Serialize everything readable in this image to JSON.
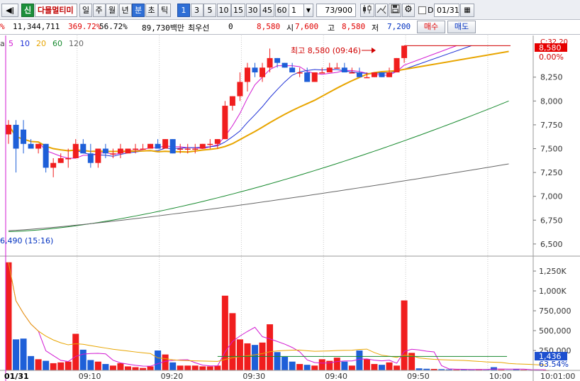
{
  "toolbar": {
    "speaker_icon": "speaker-icon",
    "code_button": "신",
    "stock_name": "다믈멀티미",
    "period_buttons": [
      "일",
      "주",
      "월",
      "년",
      "분",
      "초",
      "틱"
    ],
    "selected_period": "분",
    "interval_buttons": [
      "1",
      "3",
      "5",
      "10",
      "15",
      "30",
      "45",
      "60"
    ],
    "selected_interval": "1",
    "interval_select_value": "1",
    "count_value": "73/900",
    "icon_buttons": [
      "candle-icon",
      "cross-icon",
      "save-icon",
      "gear-icon"
    ],
    "date_checkbox_label": "D",
    "date_value": "01/31"
  },
  "info": {
    "left_cut": "%",
    "volume": "11,344,711",
    "volume_ratio": "369.72%",
    "turnover_ratio": "56.72%",
    "amount": "89,730백만",
    "prefer_label": "최우선",
    "prefer_value": "0",
    "price": "8,580",
    "open_label": "시",
    "open_value": "7,600",
    "high_label": "고",
    "high_value": "8,580",
    "low_label": "저",
    "low_value": "7,200",
    "buy_button": "매수",
    "sell_button": "매도"
  },
  "chart_data": [
    {
      "type": "candlestick",
      "legend_prefix": "a",
      "moving_averages": [
        {
          "name": "5",
          "color": "#d21ad2"
        },
        {
          "name": "10",
          "color": "#1d2fd6"
        },
        {
          "name": "20",
          "color": "#e8a500"
        },
        {
          "name": "60",
          "color": "#178a2e"
        },
        {
          "name": "120",
          "color": "#666666"
        }
      ],
      "y_ticks": [
        6500,
        6750,
        7000,
        7250,
        7500,
        7750,
        8000,
        8250
      ],
      "y_tick_labels": [
        "6,500",
        "6,750",
        "7,000",
        "7,250",
        "7,500",
        "7,750",
        "8,000",
        "8,250"
      ],
      "ylim": [
        6380,
        8650
      ],
      "top_label": "C:32.20",
      "current_price_label": "8,580",
      "change_label": "0.00%",
      "high_annotation": "최고 8,580 (09:46)",
      "low_annotation": "6,490 (15:16)",
      "candles": [
        [
          7650,
          7800,
          7550,
          7750
        ],
        [
          7750,
          7800,
          7250,
          7500
        ],
        [
          7700,
          7800,
          7450,
          7550
        ],
        [
          7550,
          7600,
          7500,
          7500
        ],
        [
          7500,
          7550,
          7450,
          7550
        ],
        [
          7550,
          7550,
          7250,
          7300
        ],
        [
          7300,
          7400,
          7200,
          7350
        ],
        [
          7350,
          7450,
          7350,
          7400
        ],
        [
          7400,
          7500,
          7300,
          7400
        ],
        [
          7400,
          7600,
          7400,
          7550
        ],
        [
          7550,
          7600,
          7450,
          7450
        ],
        [
          7450,
          7550,
          7300,
          7350
        ],
        [
          7350,
          7500,
          7300,
          7500
        ],
        [
          7500,
          7550,
          7400,
          7450
        ],
        [
          7450,
          7500,
          7400,
          7450
        ],
        [
          7450,
          7550,
          7400,
          7500
        ],
        [
          7450,
          7500,
          7450,
          7500
        ],
        [
          7500,
          7550,
          7450,
          7500
        ],
        [
          7500,
          7550,
          7500,
          7500
        ],
        [
          7500,
          7550,
          7500,
          7550
        ],
        [
          7550,
          7600,
          7500,
          7500
        ],
        [
          7500,
          7600,
          7500,
          7600
        ],
        [
          7600,
          7600,
          7450,
          7450
        ],
        [
          7500,
          7550,
          7450,
          7500
        ],
        [
          7500,
          7550,
          7450,
          7500
        ],
        [
          7500,
          7550,
          7450,
          7500
        ],
        [
          7500,
          7550,
          7500,
          7550
        ],
        [
          7550,
          7600,
          7500,
          7550
        ],
        [
          7550,
          7600,
          7500,
          7600
        ],
        [
          7600,
          8000,
          7600,
          7950
        ],
        [
          7950,
          8050,
          7900,
          8050
        ],
        [
          8050,
          8300,
          8000,
          8200
        ],
        [
          8200,
          8400,
          8100,
          8350
        ],
        [
          8350,
          8400,
          8250,
          8300
        ],
        [
          8250,
          8400,
          8200,
          8350
        ],
        [
          8350,
          8550,
          8300,
          8450
        ],
        [
          8450,
          8450,
          8350,
          8400
        ],
        [
          8400,
          8400,
          8350,
          8350
        ],
        [
          8350,
          8400,
          8300,
          8300
        ],
        [
          8300,
          8350,
          8250,
          8300
        ],
        [
          8300,
          8350,
          8200,
          8200
        ],
        [
          8200,
          8300,
          8200,
          8300
        ],
        [
          8300,
          8350,
          8300,
          8300
        ],
        [
          8300,
          8400,
          8300,
          8350
        ],
        [
          8350,
          8400,
          8350,
          8350
        ],
        [
          8350,
          8400,
          8300,
          8300
        ],
        [
          8300,
          8350,
          8300,
          8300
        ],
        [
          8300,
          8350,
          8250,
          8250
        ],
        [
          8250,
          8300,
          8250,
          8250
        ],
        [
          8250,
          8300,
          8250,
          8300
        ],
        [
          8300,
          8300,
          8250,
          8250
        ],
        [
          8250,
          8350,
          8250,
          8300
        ],
        [
          8300,
          8450,
          8300,
          8450
        ],
        [
          8450,
          8580,
          8400,
          8580
        ]
      ]
    },
    {
      "type": "bar",
      "series_name": "volume",
      "y_ticks": [
        250000,
        500000,
        750000,
        1000000,
        1250000
      ],
      "y_tick_labels": [
        "250,000",
        "500,000",
        "750,000",
        "1,000K",
        "1,250K"
      ],
      "ylim": [
        0,
        1420000
      ],
      "current_volume_label": "1,436",
      "ratio_label": "63.54%",
      "values": [
        1360000,
        390000,
        400000,
        180000,
        140000,
        120000,
        90000,
        100000,
        110000,
        460000,
        260000,
        130000,
        110000,
        80000,
        60000,
        90000,
        50000,
        40000,
        30000,
        50000,
        250000,
        200000,
        100000,
        60000,
        60000,
        60000,
        50000,
        50000,
        60000,
        940000,
        720000,
        390000,
        340000,
        320000,
        350000,
        580000,
        230000,
        170000,
        110000,
        80000,
        70000,
        60000,
        140000,
        120000,
        160000,
        110000,
        60000,
        250000,
        140000,
        80000,
        70000,
        100000,
        60000,
        880000,
        220000,
        25000,
        20000,
        18000,
        15000,
        12000,
        10000,
        12000,
        9000,
        15000,
        8000,
        40000,
        10000,
        6000,
        14000,
        8000,
        5000,
        4000,
        3000
      ]
    }
  ],
  "x_axis": {
    "date_label": "01/31",
    "tick_labels": [
      "09:10",
      "09:20",
      "09:30",
      "09:40",
      "09:50",
      "10:00"
    ],
    "right_time": "10:01:00"
  }
}
